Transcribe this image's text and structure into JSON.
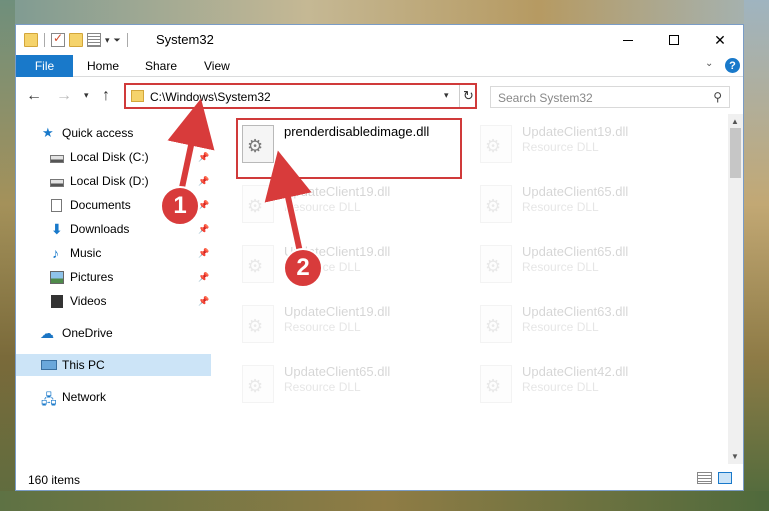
{
  "window": {
    "title": "System32"
  },
  "ribbon": {
    "tabs": [
      "File",
      "Home",
      "Share",
      "View"
    ],
    "help": "?"
  },
  "address": {
    "path": "C:\\Windows\\System32",
    "search_placeholder": "Search System32"
  },
  "sidebar": {
    "items": [
      {
        "label": "Quick access",
        "icon": "star-icon"
      },
      {
        "label": "Local Disk (C:)",
        "icon": "drive-icon",
        "pinned": true
      },
      {
        "label": "Local Disk (D:)",
        "icon": "drive-icon",
        "pinned": true
      },
      {
        "label": "Documents",
        "icon": "document-icon",
        "pinned": true
      },
      {
        "label": "Downloads",
        "icon": "download-icon",
        "pinned": true
      },
      {
        "label": "Music",
        "icon": "music-icon",
        "pinned": true
      },
      {
        "label": "Pictures",
        "icon": "pictures-icon",
        "pinned": true
      },
      {
        "label": "Videos",
        "icon": "videos-icon",
        "pinned": true
      },
      {
        "label": "OneDrive",
        "icon": "cloud-icon"
      },
      {
        "label": "This PC",
        "icon": "computer-icon",
        "selected": true
      },
      {
        "label": "Network",
        "icon": "network-icon"
      }
    ]
  },
  "files": [
    {
      "name": "prenderdisabledimage.dll",
      "type": "",
      "highlighted": true
    },
    {
      "name": "UpdateClient19.dll",
      "type": "Resource DLL",
      "faded": true
    },
    {
      "name": "UpdateClient19.dll",
      "type": "Resource DLL",
      "faded": true
    },
    {
      "name": "UpdateClient65.dll",
      "type": "Resource DLL",
      "faded": true
    },
    {
      "name": "UpdateClient19.dll",
      "type": "Resource DLL",
      "faded": true
    },
    {
      "name": "UpdateClient65.dll",
      "type": "Resource DLL",
      "faded": true
    },
    {
      "name": "UpdateClient19.dll",
      "type": "Resource DLL",
      "faded": true
    },
    {
      "name": "UpdateClient63.dll",
      "type": "Resource DLL",
      "faded": true
    },
    {
      "name": "UpdateClient65.dll",
      "type": "Resource DLL",
      "faded": true
    },
    {
      "name": "UpdateClient42.dll",
      "type": "Resource DLL",
      "faded": true
    }
  ],
  "status": {
    "item_count": "160 items"
  },
  "annotations": {
    "step1": "1",
    "step2": "2"
  },
  "colors": {
    "accent": "#1979ca",
    "annotation": "#d83b3b",
    "selection": "#cce4f7"
  }
}
